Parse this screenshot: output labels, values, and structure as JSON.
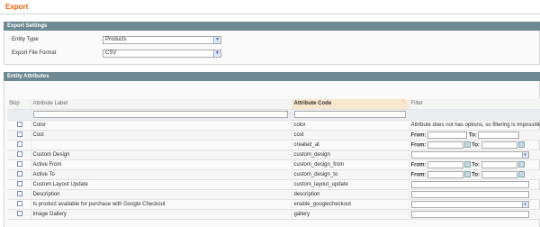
{
  "page": {
    "title": "Export"
  },
  "export_settings": {
    "header": "Export Settings",
    "entity_type_label": "Entity Type",
    "entity_type_value": "Products",
    "file_format_label": "Export File Format",
    "file_format_value": "CSV"
  },
  "entity_attributes": {
    "header": "Entity Attributes",
    "columns": {
      "skip": "Skip",
      "label": "Attribute Label",
      "code": "Attribute Code",
      "filter": "Filter"
    },
    "rows": [
      {
        "label": "Color",
        "code": "color",
        "filter_type": "text",
        "filter_text": "Attribute does not has options, so filtering is impossible"
      },
      {
        "label": "Cost",
        "code": "cost",
        "filter_type": "range"
      },
      {
        "label": "",
        "code": "created_at",
        "filter_type": "date"
      },
      {
        "label": "Custom Design",
        "code": "custom_design",
        "filter_type": "select"
      },
      {
        "label": "Active From",
        "code": "custom_design_from",
        "filter_type": "date"
      },
      {
        "label": "Active To",
        "code": "custom_design_to",
        "filter_type": "date"
      },
      {
        "label": "Custom Layout Update",
        "code": "custom_layout_update",
        "filter_type": "input"
      },
      {
        "label": "Description",
        "code": "description",
        "filter_type": "input"
      },
      {
        "label": "Is product available for purchase with Google Checkout",
        "code": "enable_googlecheckout",
        "filter_type": "select"
      },
      {
        "label": "Image Gallery",
        "code": "gallery",
        "filter_type": "input"
      }
    ],
    "filter_labels": {
      "from": "From:",
      "to": "To:"
    }
  }
}
